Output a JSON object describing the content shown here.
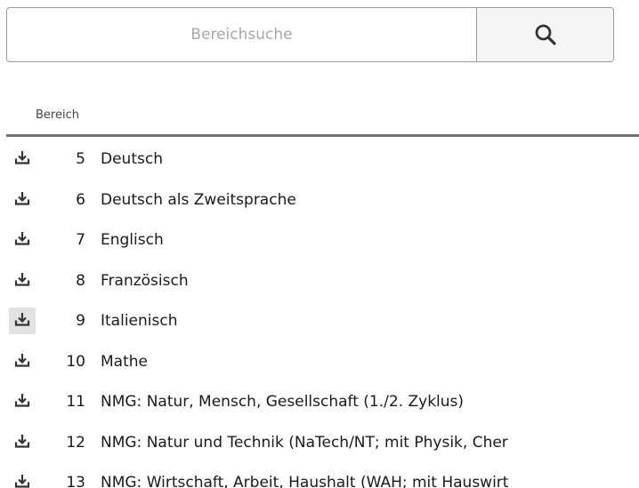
{
  "search": {
    "placeholder": "Bereichsuche",
    "value": "",
    "button_icon": "search-icon"
  },
  "table": {
    "column_header": "Bereich",
    "rows": [
      {
        "num": "5",
        "label": "Deutsch",
        "icon": "download-icon",
        "hovered": false
      },
      {
        "num": "6",
        "label": "Deutsch als Zweitsprache",
        "icon": "download-icon",
        "hovered": false
      },
      {
        "num": "7",
        "label": "Englisch",
        "icon": "download-icon",
        "hovered": false
      },
      {
        "num": "8",
        "label": "Französisch",
        "icon": "download-icon",
        "hovered": false
      },
      {
        "num": "9",
        "label": "Italienisch",
        "icon": "download-icon",
        "hovered": true
      },
      {
        "num": "10",
        "label": "Mathe",
        "icon": "download-icon",
        "hovered": false
      },
      {
        "num": "11",
        "label": "NMG: Natur, Mensch, Gesellschaft (1./2. Zyklus)",
        "icon": "download-icon",
        "hovered": false
      },
      {
        "num": "12",
        "label": "NMG: Natur und Technik (NaTech/NT; mit Physik, Cher",
        "icon": "download-icon",
        "hovered": false
      },
      {
        "num": "13",
        "label": "NMG: Wirtschaft, Arbeit, Haushalt (WAH; mit Hauswirt",
        "icon": "download-icon",
        "hovered": false
      }
    ]
  },
  "colors": {
    "border": "#9a9a9a",
    "rule": "#6f6f6f",
    "icon": "#333333",
    "hover_bg": "#e2e2e2"
  }
}
